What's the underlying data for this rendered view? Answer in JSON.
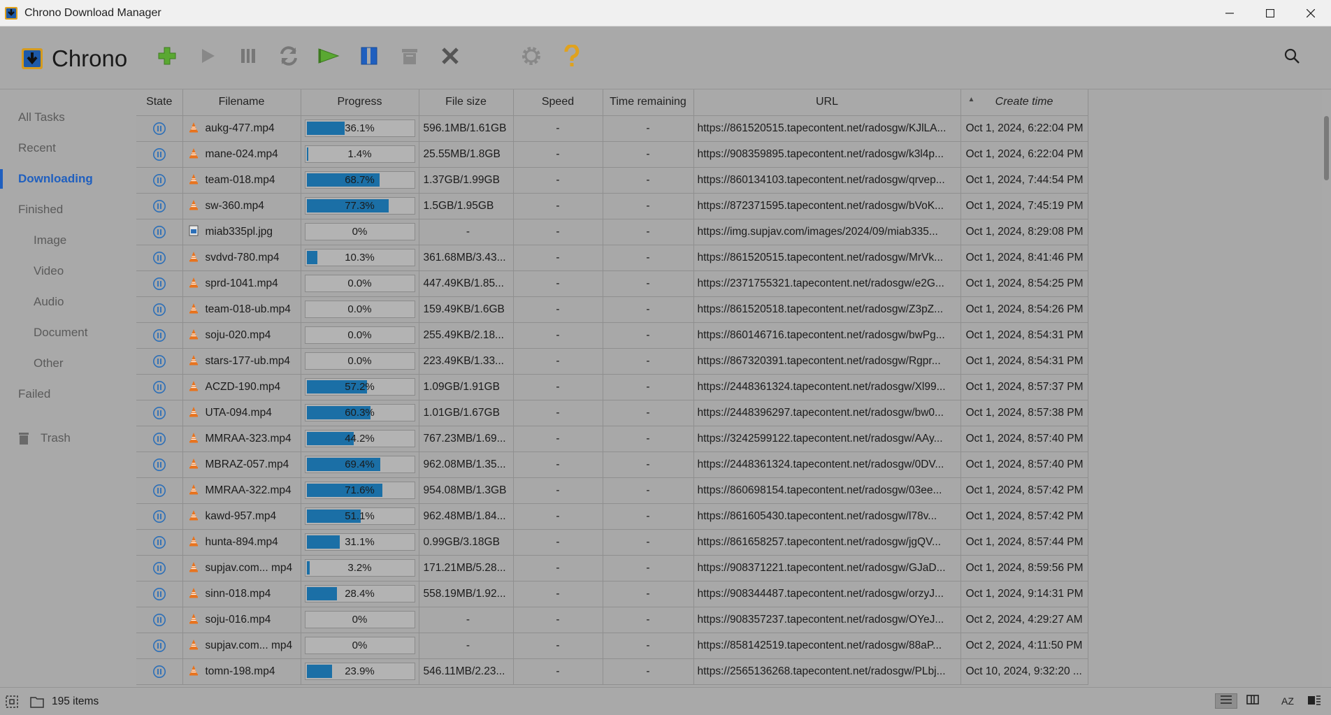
{
  "window": {
    "title": "Chrono Download Manager"
  },
  "brand": {
    "name": "Chrono"
  },
  "toolbar": {
    "buttons": [
      {
        "name": "new-download",
        "icon": "plus-icon"
      },
      {
        "name": "start",
        "icon": "play-icon"
      },
      {
        "name": "pause",
        "icon": "pause-icon"
      },
      {
        "name": "redownload",
        "icon": "refresh-icon"
      },
      {
        "name": "start-all",
        "icon": "play-all-icon"
      },
      {
        "name": "pause-all",
        "icon": "pause-all-icon"
      },
      {
        "name": "clear",
        "icon": "trash-bin-icon"
      },
      {
        "name": "delete",
        "icon": "close-icon"
      },
      {
        "name": "settings",
        "icon": "gear-icon"
      },
      {
        "name": "help",
        "icon": "help-icon"
      }
    ],
    "colors": {
      "green": "#4caf3a",
      "blue": "#1f5fbf",
      "gray": "#7a7a7a",
      "yellow": "#e6a21a"
    }
  },
  "sidebar": {
    "items": [
      {
        "label": "All Tasks",
        "level": "top",
        "active": false
      },
      {
        "label": "Recent",
        "level": "top",
        "active": false
      },
      {
        "label": "Downloading",
        "level": "top",
        "active": true
      },
      {
        "label": "Finished",
        "level": "top",
        "active": false
      },
      {
        "label": "Image",
        "level": "sub",
        "active": false
      },
      {
        "label": "Video",
        "level": "sub",
        "active": false
      },
      {
        "label": "Audio",
        "level": "sub",
        "active": false
      },
      {
        "label": "Document",
        "level": "sub",
        "active": false
      },
      {
        "label": "Other",
        "level": "sub",
        "active": false
      },
      {
        "label": "Failed",
        "level": "top",
        "active": false
      }
    ],
    "trash_label": "Trash"
  },
  "table": {
    "columns": [
      "State",
      "Filename",
      "Progress",
      "File size",
      "Speed",
      "Time remaining",
      "URL",
      "Create time"
    ],
    "sort_column": "Create time",
    "rows": [
      {
        "state": "paused",
        "type": "video",
        "filename": "aukg-477.mp4",
        "progress": 36.1,
        "progress_label": "36.1%",
        "size": "596.1MB/1.61GB",
        "speed": "-",
        "remaining": "-",
        "url": "https://861520515.tapecontent.net/radosgw/KJlLA...",
        "created": "Oct 1, 2024, 6:22:04 PM"
      },
      {
        "state": "paused",
        "type": "video",
        "filename": "mane-024.mp4",
        "progress": 1.4,
        "progress_label": "1.4%",
        "size": "25.55MB/1.8GB",
        "speed": "-",
        "remaining": "-",
        "url": "https://908359895.tapecontent.net/radosgw/k3l4p...",
        "created": "Oct 1, 2024, 6:22:04 PM"
      },
      {
        "state": "paused",
        "type": "video",
        "filename": "team-018.mp4",
        "progress": 68.7,
        "progress_label": "68.7%",
        "size": "1.37GB/1.99GB",
        "speed": "-",
        "remaining": "-",
        "url": "https://860134103.tapecontent.net/radosgw/qrvep...",
        "created": "Oct 1, 2024, 7:44:54 PM"
      },
      {
        "state": "paused",
        "type": "video",
        "filename": "sw-360.mp4",
        "progress": 77.3,
        "progress_label": "77.3%",
        "size": "1.5GB/1.95GB",
        "speed": "-",
        "remaining": "-",
        "url": "https://872371595.tapecontent.net/radosgw/bVoK...",
        "created": "Oct 1, 2024, 7:45:19 PM"
      },
      {
        "state": "paused",
        "type": "image",
        "filename": "miab335pl.jpg",
        "progress": 0,
        "progress_label": "0%",
        "size": "-",
        "speed": "-",
        "remaining": "-",
        "url": "https://img.supjav.com/images/2024/09/miab335...",
        "created": "Oct 1, 2024, 8:29:08 PM"
      },
      {
        "state": "paused",
        "type": "video",
        "filename": "svdvd-780.mp4",
        "progress": 10.3,
        "progress_label": "10.3%",
        "size": "361.68MB/3.43...",
        "speed": "-",
        "remaining": "-",
        "url": "https://861520515.tapecontent.net/radosgw/MrVk...",
        "created": "Oct 1, 2024, 8:41:46 PM"
      },
      {
        "state": "paused",
        "type": "video",
        "filename": "sprd-1041.mp4",
        "progress": 0,
        "progress_label": "0.0%",
        "size": "447.49KB/1.85...",
        "speed": "-",
        "remaining": "-",
        "url": "https://2371755321.tapecontent.net/radosgw/e2G...",
        "created": "Oct 1, 2024, 8:54:25 PM"
      },
      {
        "state": "paused",
        "type": "video",
        "filename": "team-018-ub.mp4",
        "progress": 0,
        "progress_label": "0.0%",
        "size": "159.49KB/1.6GB",
        "speed": "-",
        "remaining": "-",
        "url": "https://861520518.tapecontent.net/radosgw/Z3pZ...",
        "created": "Oct 1, 2024, 8:54:26 PM"
      },
      {
        "state": "paused",
        "type": "video",
        "filename": "soju-020.mp4",
        "progress": 0,
        "progress_label": "0.0%",
        "size": "255.49KB/2.18...",
        "speed": "-",
        "remaining": "-",
        "url": "https://860146716.tapecontent.net/radosgw/bwPg...",
        "created": "Oct 1, 2024, 8:54:31 PM"
      },
      {
        "state": "paused",
        "type": "video",
        "filename": "stars-177-ub.mp4",
        "progress": 0,
        "progress_label": "0.0%",
        "size": "223.49KB/1.33...",
        "speed": "-",
        "remaining": "-",
        "url": "https://867320391.tapecontent.net/radosgw/Rgpr...",
        "created": "Oct 1, 2024, 8:54:31 PM"
      },
      {
        "state": "paused",
        "type": "video",
        "filename": "ACZD-190.mp4",
        "progress": 57.2,
        "progress_label": "57.2%",
        "size": "1.09GB/1.91GB",
        "speed": "-",
        "remaining": "-",
        "url": "https://2448361324.tapecontent.net/radosgw/Xl99...",
        "created": "Oct 1, 2024, 8:57:37 PM"
      },
      {
        "state": "paused",
        "type": "video",
        "filename": "UTA-094.mp4",
        "progress": 60.3,
        "progress_label": "60.3%",
        "size": "1.01GB/1.67GB",
        "speed": "-",
        "remaining": "-",
        "url": "https://2448396297.tapecontent.net/radosgw/bw0...",
        "created": "Oct 1, 2024, 8:57:38 PM"
      },
      {
        "state": "paused",
        "type": "video",
        "filename": "MMRAA-323.mp4",
        "progress": 44.2,
        "progress_label": "44.2%",
        "size": "767.23MB/1.69...",
        "speed": "-",
        "remaining": "-",
        "url": "https://3242599122.tapecontent.net/radosgw/AAy...",
        "created": "Oct 1, 2024, 8:57:40 PM"
      },
      {
        "state": "paused",
        "type": "video",
        "filename": "MBRAZ-057.mp4",
        "progress": 69.4,
        "progress_label": "69.4%",
        "size": "962.08MB/1.35...",
        "speed": "-",
        "remaining": "-",
        "url": "https://2448361324.tapecontent.net/radosgw/0DV...",
        "created": "Oct 1, 2024, 8:57:40 PM"
      },
      {
        "state": "paused",
        "type": "video",
        "filename": "MMRAA-322.mp4",
        "progress": 71.6,
        "progress_label": "71.6%",
        "size": "954.08MB/1.3GB",
        "speed": "-",
        "remaining": "-",
        "url": "https://860698154.tapecontent.net/radosgw/03ee...",
        "created": "Oct 1, 2024, 8:57:42 PM"
      },
      {
        "state": "paused",
        "type": "video",
        "filename": "kawd-957.mp4",
        "progress": 51.1,
        "progress_label": "51.1%",
        "size": "962.48MB/1.84...",
        "speed": "-",
        "remaining": "-",
        "url": "https://861605430.tapecontent.net/radosgw/l78v...",
        "created": "Oct 1, 2024, 8:57:42 PM"
      },
      {
        "state": "paused",
        "type": "video",
        "filename": "hunta-894.mp4",
        "progress": 31.1,
        "progress_label": "31.1%",
        "size": "0.99GB/3.18GB",
        "speed": "-",
        "remaining": "-",
        "url": "https://861658257.tapecontent.net/radosgw/jgQV...",
        "created": "Oct 1, 2024, 8:57:44 PM"
      },
      {
        "state": "paused",
        "type": "video",
        "filename": "supjav.com... mp4",
        "progress": 3.2,
        "progress_label": "3.2%",
        "size": "171.21MB/5.28...",
        "speed": "-",
        "remaining": "-",
        "url": "https://908371221.tapecontent.net/radosgw/GJaD...",
        "created": "Oct 1, 2024, 8:59:56 PM"
      },
      {
        "state": "paused",
        "type": "video",
        "filename": "sinn-018.mp4",
        "progress": 28.4,
        "progress_label": "28.4%",
        "size": "558.19MB/1.92...",
        "speed": "-",
        "remaining": "-",
        "url": "https://908344487.tapecontent.net/radosgw/orzyJ...",
        "created": "Oct 1, 2024, 9:14:31 PM"
      },
      {
        "state": "paused",
        "type": "video",
        "filename": "soju-016.mp4",
        "progress": 0,
        "progress_label": "0%",
        "size": "-",
        "speed": "-",
        "remaining": "-",
        "url": "https://908357237.tapecontent.net/radosgw/OYeJ...",
        "created": "Oct 2, 2024, 4:29:27 AM"
      },
      {
        "state": "paused",
        "type": "video",
        "filename": "supjav.com... mp4",
        "progress": 0,
        "progress_label": "0%",
        "size": "-",
        "speed": "-",
        "remaining": "-",
        "url": "https://858142519.tapecontent.net/radosgw/88aP...",
        "created": "Oct 2, 2024, 4:11:50 PM"
      },
      {
        "state": "paused",
        "type": "video",
        "filename": "tomn-198.mp4",
        "progress": 23.9,
        "progress_label": "23.9%",
        "size": "546.11MB/2.23...",
        "speed": "-",
        "remaining": "-",
        "url": "https://2565136268.tapecontent.net/radosgw/PLbj...",
        "created": "Oct 10, 2024, 9:32:20 ..."
      }
    ]
  },
  "status": {
    "count_label": "195 items",
    "sort_label": "AZ"
  },
  "colors": {
    "progress_fill": "#1b6fa6",
    "accent": "#1f5fbf",
    "vlc_orange": "#e8731e",
    "state_blue": "#2c6fb8"
  }
}
